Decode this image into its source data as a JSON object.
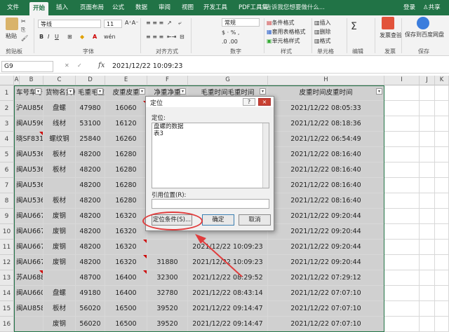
{
  "tabs": {
    "file": "文件",
    "home": "开始",
    "insert": "插入",
    "layout": "页面布局",
    "formula": "公式",
    "data": "数据",
    "review": "审阅",
    "view": "视图",
    "dev": "开发工具",
    "pdf": "PDF工具集",
    "tell": "告诉我您想要做什么...",
    "login": "登录",
    "share": "共享"
  },
  "ribbon": {
    "paste": "粘贴",
    "clipboard": "剪贴板",
    "font_name": "等线",
    "font_size": "11",
    "font": "字体",
    "align": "对齐方式",
    "number_format": "常规",
    "number": "数字",
    "cond_fmt": "条件格式",
    "table_fmt": "套用表格格式",
    "cell_style": "单元格样式",
    "styles": "样式",
    "insert": "插入",
    "delete": "删除",
    "format": "格式",
    "cells": "单元格",
    "editing": "编辑",
    "invoice": "发票查验",
    "invoice2": "发票",
    "save_cloud": "保存到百度网盘",
    "save2": "保存"
  },
  "formula": {
    "namebox": "G9",
    "fx": "fx",
    "content": "2021/12/22  10:09:23"
  },
  "columns": [
    "A",
    "B",
    "C",
    "D",
    "E",
    "F",
    "G",
    "H",
    "I",
    "J",
    "K"
  ],
  "headers": {
    "b": "车号",
    "c": "货物名",
    "d": "毛重",
    "e": "皮重",
    "f": "净重",
    "g": "毛重时间",
    "h": "皮重时间"
  },
  "rows": [
    {
      "n": "1"
    },
    {
      "n": "2",
      "b": "沪AU856",
      "c": "盘螺",
      "d": "47980",
      "e": "16060",
      "f": "",
      "g": "",
      "h": "2021/12/22 08:05:33"
    },
    {
      "n": "3",
      "b": "闽AU596",
      "c": "线材",
      "d": "53100",
      "e": "16120",
      "f": "",
      "g": "",
      "h": "2021/12/22 08:18:36"
    },
    {
      "n": "4",
      "b": "晓SF831",
      "c": "螺纹钢",
      "d": "25840",
      "e": "16260",
      "f": "",
      "g": "",
      "h": "2021/12/22 06:54:49"
    },
    {
      "n": "5",
      "b": "闽AU536",
      "c": "板材",
      "d": "48200",
      "e": "16280",
      "f": "",
      "g": "",
      "h": "2021/12/22 08:16:40"
    },
    {
      "n": "6",
      "b": "闽AU536",
      "c": "板材",
      "d": "48200",
      "e": "16280",
      "f": "",
      "g": "",
      "h": "2021/12/22 08:16:40"
    },
    {
      "n": "7",
      "b": "闽AU536",
      "c": "",
      "d": "48200",
      "e": "16280",
      "f": "",
      "g": "",
      "h": "2021/12/22 08:16:40"
    },
    {
      "n": "8",
      "b": "闽AU536",
      "c": "板材",
      "d": "48200",
      "e": "16280",
      "f": "",
      "g": "",
      "h": "2021/12/22 08:16:40"
    },
    {
      "n": "9",
      "b": "闽AU667",
      "c": "废钢",
      "d": "48200",
      "e": "16320",
      "f": "",
      "g": "",
      "h": "2021/12/22 09:20:44"
    },
    {
      "n": "10",
      "b": "闽AU667",
      "c": "废钢",
      "d": "48200",
      "e": "16320",
      "f": "",
      "g": "",
      "h": "2021/12/22 09:20:44"
    },
    {
      "n": "11",
      "b": "闽AU667",
      "c": "废钢",
      "d": "48200",
      "e": "16320",
      "f": "",
      "g": "2021/12/22 10:09:23",
      "h": "2021/12/22 09:20:44"
    },
    {
      "n": "12",
      "b": "闽AU667",
      "c": "废钢",
      "d": "48200",
      "e": "16320",
      "f": "31880",
      "g": "2021/12/22 10:09:23",
      "h": "2021/12/22 09:20:44"
    },
    {
      "n": "13",
      "b": "苏AU688",
      "c": "",
      "d": "48700",
      "e": "16400",
      "f": "32300",
      "g": "2021/12/22 08:29:52",
      "h": "2021/12/22 07:29:12"
    },
    {
      "n": "14",
      "b": "闽AU660",
      "c": "盘螺",
      "d": "49180",
      "e": "16400",
      "f": "32780",
      "g": "2021/12/22 08:43:14",
      "h": "2021/12/22 07:07:10"
    },
    {
      "n": "15",
      "b": "闽AU858",
      "c": "板材",
      "d": "56020",
      "e": "16500",
      "f": "39520",
      "g": "2021/12/22 09:14:47",
      "h": "2021/12/22 07:07:10"
    },
    {
      "n": "16",
      "b": "",
      "c": "废钢",
      "d": "56020",
      "e": "16500",
      "f": "39520",
      "g": "2021/12/22 09:14:47",
      "h": "2021/12/22 07:07:10"
    }
  ],
  "dialog": {
    "title": "定位",
    "help": "?",
    "close": "×",
    "goto_label": "定位:",
    "items": [
      "盘螺的数据",
      "表3"
    ],
    "ref_label": "引用位置(R):",
    "ref_value": "",
    "special": "定位条件(S)...",
    "ok": "确定",
    "cancel": "取消"
  }
}
